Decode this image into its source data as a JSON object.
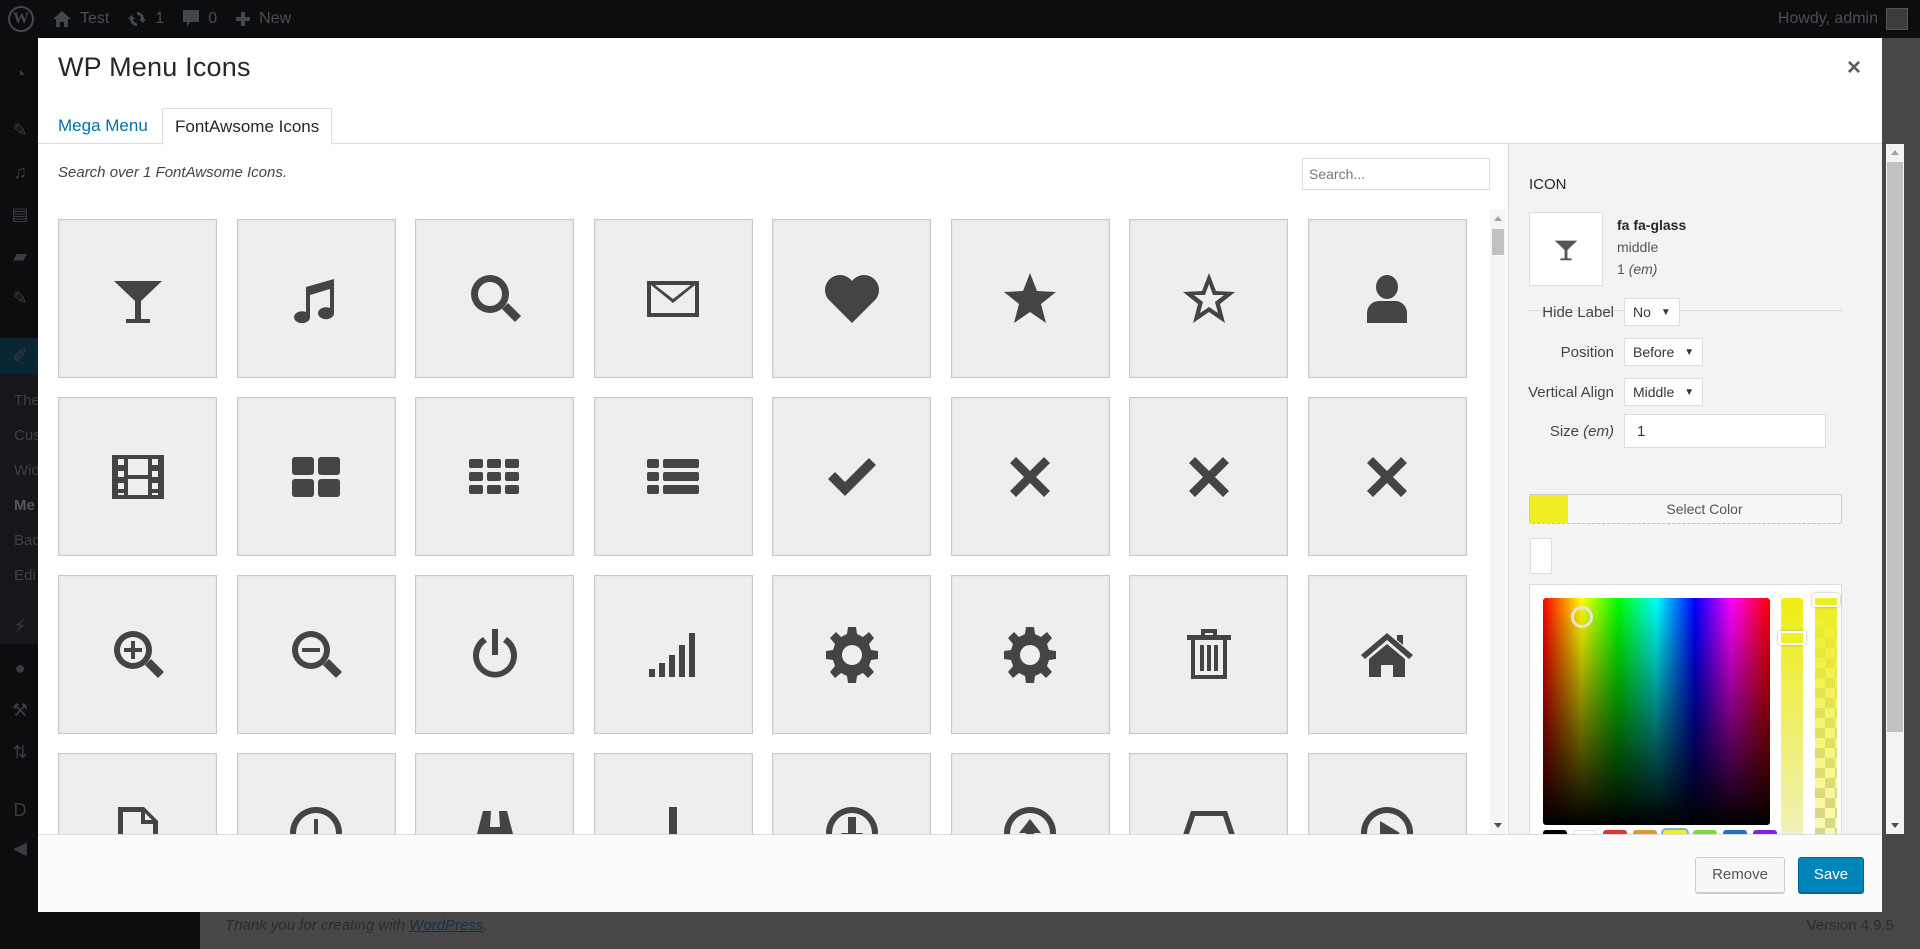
{
  "adminbar": {
    "site_name": "Test",
    "updates_count": "1",
    "comments_count": "0",
    "new_label": "New",
    "greeting": "Howdy, admin"
  },
  "sidebar": {
    "submenu": [
      "The",
      "Cus",
      "Wid",
      "Me",
      "Bac",
      "Edi"
    ]
  },
  "footer": {
    "thanks_prefix": "Thank you for creating with ",
    "thanks_link": "WordPress",
    "thanks_suffix": ".",
    "version": "Version 4.9.5"
  },
  "modal": {
    "title": "WP Menu Icons",
    "close_label": "×",
    "tabs": [
      {
        "label": "Mega Menu",
        "active": false
      },
      {
        "label": "FontAwsome Icons",
        "active": true
      }
    ],
    "search_info": "Search over 1 FontAwsome Icons.",
    "search_placeholder": "Search...",
    "icons": [
      "glass",
      "music",
      "search",
      "envelope-o",
      "heart",
      "star",
      "star-o",
      "user",
      "film",
      "th-large",
      "th",
      "th-list",
      "check",
      "times",
      "times",
      "times",
      "search-plus",
      "search-minus",
      "power-off",
      "signal",
      "cog",
      "cog",
      "trash-o",
      "home",
      "file-o",
      "clock-o",
      "road",
      "download",
      "arrow-circle-o-down",
      "arrow-circle-o-up",
      "inbox",
      "play-circle-o"
    ]
  },
  "panel": {
    "section_label": "ICON",
    "selected_class": "fa fa-glass",
    "selected_align": "middle",
    "selected_size": "1",
    "selected_size_unit": "(em)",
    "fields": {
      "hide_label": {
        "label": "Hide Label",
        "value": "No"
      },
      "position": {
        "label": "Position",
        "value": "Before"
      },
      "vertical_align": {
        "label": "Vertical Align",
        "value": "Middle"
      },
      "size": {
        "label": "Size",
        "unit": "(em)",
        "value": "1"
      }
    },
    "color_button_label": "Select Color",
    "current_color": "#eeee22",
    "palette": [
      "#000000",
      "#ffffff",
      "#dd3333",
      "#dd9933",
      "#eeee22",
      "#81d742",
      "#1e73be",
      "#8224e3"
    ]
  },
  "buttons": {
    "remove": "Remove",
    "save": "Save"
  }
}
